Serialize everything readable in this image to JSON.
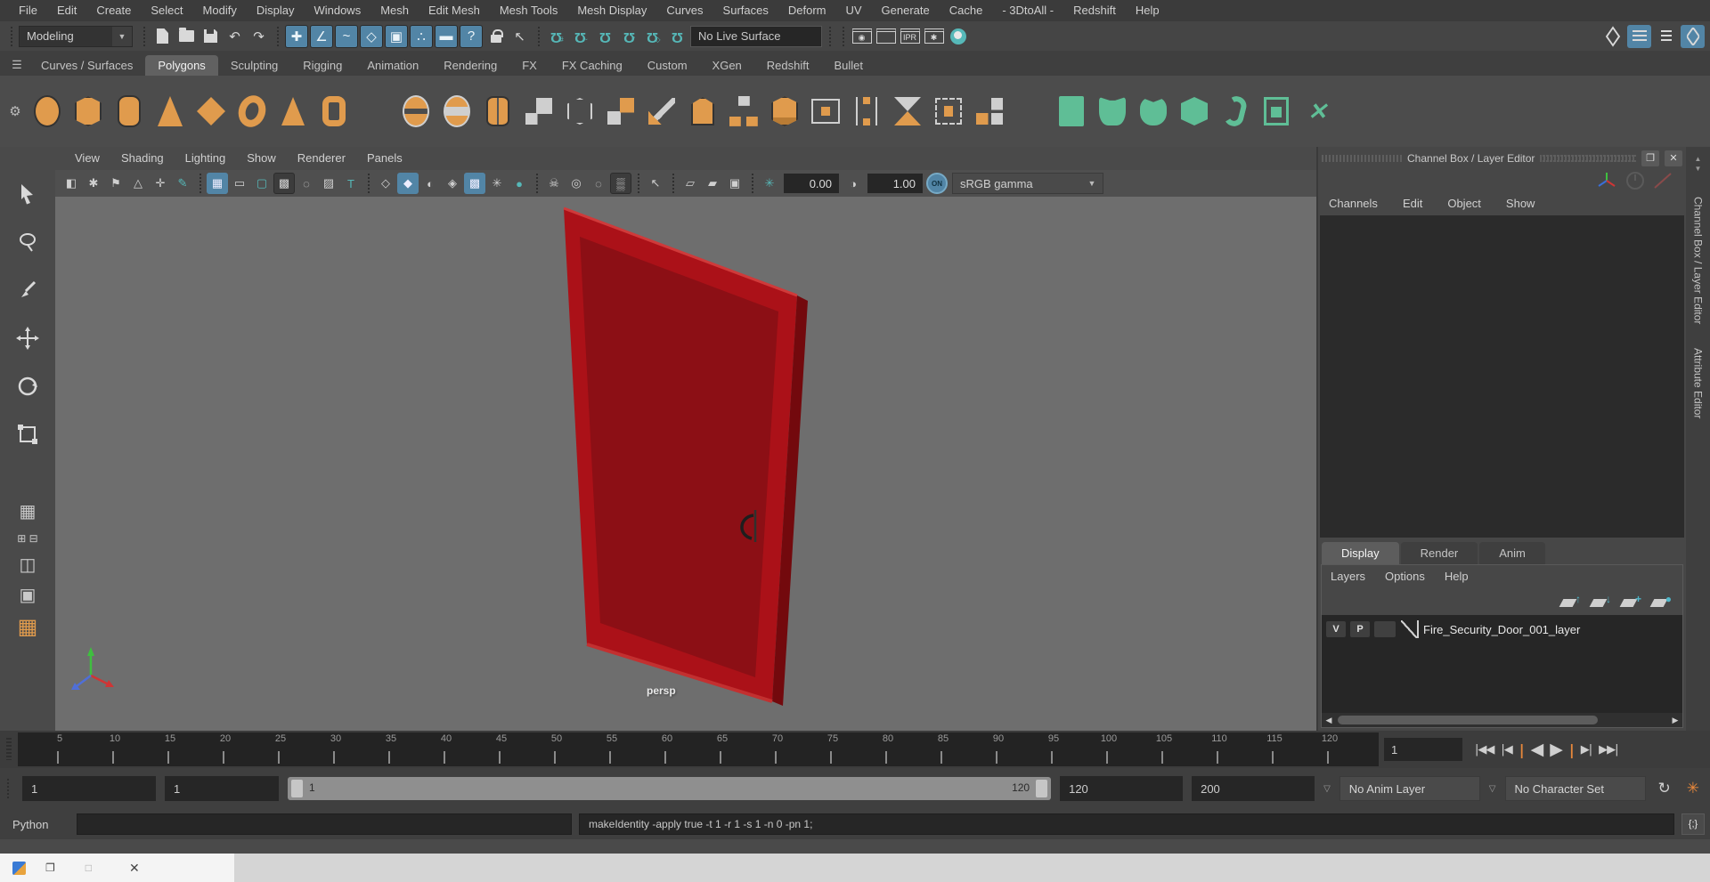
{
  "menu_bar": {
    "items": [
      "File",
      "Edit",
      "Create",
      "Select",
      "Modify",
      "Display",
      "Windows",
      "Mesh",
      "Edit Mesh",
      "Mesh Tools",
      "Mesh Display",
      "Curves",
      "Surfaces",
      "Deform",
      "UV",
      "Generate",
      "Cache",
      "- 3DtoAll -",
      "Redshift",
      "Help"
    ]
  },
  "status_line": {
    "mode_selector": "Modeling",
    "live_surface_label": "No Live Surface",
    "ipr_label": "IPR"
  },
  "shelf": {
    "tabs": [
      {
        "label": "Curves / Surfaces"
      },
      {
        "label": "Polygons",
        "active": true
      },
      {
        "label": "Sculpting"
      },
      {
        "label": "Rigging"
      },
      {
        "label": "Animation"
      },
      {
        "label": "Rendering"
      },
      {
        "label": "FX"
      },
      {
        "label": "FX Caching"
      },
      {
        "label": "Custom"
      },
      {
        "label": "XGen"
      },
      {
        "label": "Redshift"
      },
      {
        "label": "Bullet"
      }
    ],
    "items": [
      {
        "name": "poly-sphere-icon",
        "shape": "sphere"
      },
      {
        "name": "poly-cube-icon",
        "shape": "cube"
      },
      {
        "name": "poly-cylinder-icon",
        "shape": "cylinder"
      },
      {
        "name": "poly-cone-icon",
        "shape": "cone"
      },
      {
        "name": "poly-plane-icon",
        "shape": "plane"
      },
      {
        "name": "poly-torus-icon",
        "shape": "torus"
      },
      {
        "name": "poly-pyramid-icon",
        "shape": "pyramid"
      },
      {
        "name": "poly-pipe-icon",
        "shape": "pipe"
      },
      {
        "name": "shelf-separator",
        "shape": "sep"
      },
      {
        "name": "combine-icon",
        "shape": "dia2"
      },
      {
        "name": "separate-icon",
        "shape": "dia2b"
      },
      {
        "name": "mirror-cut-icon",
        "shape": "cylsplit"
      },
      {
        "name": "smooth-icon",
        "shape": "gridsq"
      },
      {
        "name": "subdiv-proxy-icon",
        "shape": "cubewire"
      },
      {
        "name": "reduce-icon",
        "shape": "gridsq2"
      },
      {
        "name": "multi-cut-icon",
        "shape": "knife"
      },
      {
        "name": "extrude-icon",
        "shape": "extrude"
      },
      {
        "name": "quad-draw-icon",
        "shape": "dia3"
      },
      {
        "name": "bevel-icon",
        "shape": "ycube"
      },
      {
        "name": "bridge-icon",
        "shape": "bracket"
      },
      {
        "name": "edge-loop-icon",
        "shape": "handles"
      },
      {
        "name": "mirror-icon",
        "shape": "mirror2"
      },
      {
        "name": "lattice-icon",
        "shape": "boxx"
      },
      {
        "name": "duplicate-icon",
        "shape": "sq4"
      },
      {
        "name": "shelf-separator",
        "shape": "sep"
      },
      {
        "name": "uv-planar-map-icon",
        "shape": "gsq"
      },
      {
        "name": "uv-cylindrical-map-icon",
        "shape": "gnotch"
      },
      {
        "name": "uv-spherical-map-icon",
        "shape": "gnotch2"
      },
      {
        "name": "uv-automatic-map-icon",
        "shape": "gcube"
      },
      {
        "name": "uv-unfold-icon",
        "shape": "gsnake"
      },
      {
        "name": "uv-editor-icon",
        "shape": "gwin"
      },
      {
        "name": "uv-layout-icon",
        "shape": "gx"
      }
    ]
  },
  "panel_menu": {
    "items": [
      "View",
      "Shading",
      "Lighting",
      "Show",
      "Renderer",
      "Panels"
    ]
  },
  "viewport": {
    "camera_label": "persp",
    "exposure": "0.00",
    "gamma": "1.00",
    "color_mgmt_toggle": "ON",
    "view_transform": "sRGB gamma",
    "door_frame_color": "#ab1118",
    "door_panel_color": "#8c0f15",
    "door_side_color": "#73090d"
  },
  "channel_box": {
    "title": "Channel Box / Layer Editor",
    "menus": [
      "Channels",
      "Edit",
      "Object",
      "Show"
    ]
  },
  "side_tabs": [
    "Channel Box / Layer Editor",
    "Attribute Editor"
  ],
  "layer_editor": {
    "tabs": [
      {
        "label": "Display",
        "active": true
      },
      {
        "label": "Render"
      },
      {
        "label": "Anim"
      }
    ],
    "menus": [
      "Layers",
      "Options",
      "Help"
    ],
    "layer": {
      "visibility": "V",
      "playback": "P",
      "name": "Fire_Security_Door_001_layer"
    }
  },
  "timeline": {
    "tick_labels": [
      "5",
      "10",
      "15",
      "20",
      "25",
      "30",
      "35",
      "40",
      "45",
      "50",
      "55",
      "60",
      "65",
      "70",
      "75",
      "80",
      "85",
      "90",
      "95",
      "100",
      "105",
      "110",
      "115",
      "120"
    ],
    "current_frame": "1",
    "frame_field": "1",
    "controls": [
      {
        "name": "go-to-start-button",
        "glyph": "|◀◀",
        "cls": ""
      },
      {
        "name": "step-back-frame-button",
        "glyph": "|◀",
        "cls": ""
      },
      {
        "name": "step-back-key-button",
        "glyph": "|",
        "cls": "accent"
      },
      {
        "name": "play-backwards-button",
        "glyph": "◀",
        "cls": "big"
      },
      {
        "name": "play-forwards-button",
        "glyph": "▶",
        "cls": "big"
      },
      {
        "name": "step-forward-key-button",
        "glyph": "|",
        "cls": "accent"
      },
      {
        "name": "step-forward-frame-button",
        "glyph": "▶|",
        "cls": ""
      },
      {
        "name": "go-to-end-button",
        "glyph": "▶▶|",
        "cls": ""
      }
    ]
  },
  "range_slider": {
    "anim_start": "1",
    "playback_start": "1",
    "range_start_label": "1",
    "range_end_label": "120",
    "playback_end": "120",
    "anim_end": "200",
    "anim_layer": "No Anim Layer",
    "character_set": "No Character Set"
  },
  "command_line": {
    "language_label": "Python",
    "input_value": "",
    "output_value": "makeIdentity -apply true -t 1 -r 1 -s 1 -n 0 -pn 1;"
  },
  "colors": {
    "accent_blue": "#5285a6",
    "icon_teal": "#56b8b8",
    "icon_orange": "#e09b4d",
    "shelf_green": "#5fbe96",
    "door_red": "#ab1118",
    "viewport_gray": "#6e6e6e"
  }
}
